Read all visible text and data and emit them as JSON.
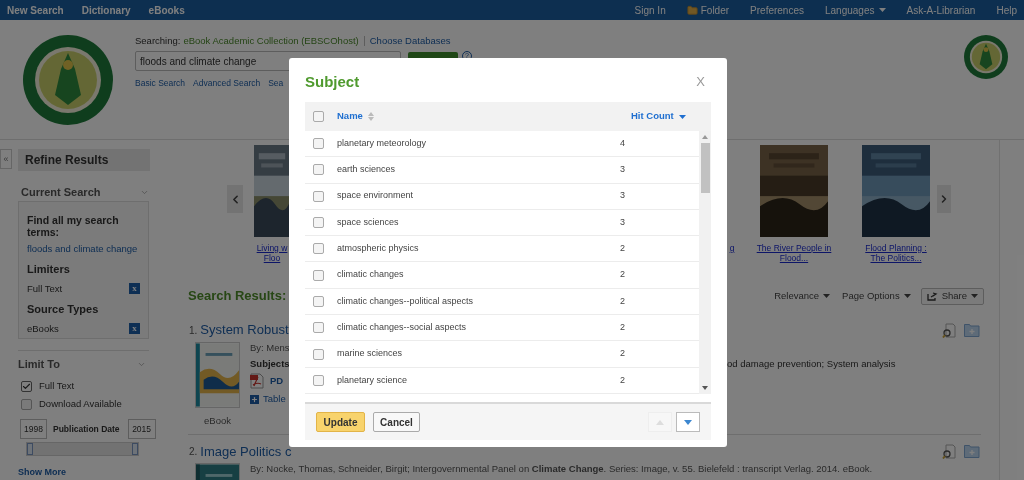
{
  "top_nav": {
    "left": [
      "New Search",
      "Dictionary",
      "eBooks"
    ],
    "right": [
      {
        "label": "Sign In",
        "kind": "link"
      },
      {
        "label": "Folder",
        "kind": "folder"
      },
      {
        "label": "Preferences",
        "kind": "link"
      },
      {
        "label": "Languages",
        "kind": "dropdown"
      },
      {
        "label": "Ask-A-Librarian",
        "kind": "link"
      },
      {
        "label": "Help",
        "kind": "link"
      }
    ]
  },
  "search": {
    "searching_label": "Searching:",
    "database": "eBook Academic Collection (EBSCOhost)",
    "choose_databases": "Choose Databases",
    "query": "floods and climate change",
    "help": "?",
    "links": [
      "Basic Search",
      "Advanced Search",
      "Sea"
    ]
  },
  "sidebar": {
    "collapse": "«",
    "title": "Refine Results",
    "current_search": {
      "heading": "Current Search",
      "find_label": "Find all my search terms:",
      "term": "floods and climate change",
      "limiters_heading": "Limiters",
      "limiters": [
        {
          "label": "Full Text",
          "remove": "x"
        }
      ],
      "source_types_heading": "Source Types",
      "source_types": [
        {
          "label": "eBooks",
          "remove": "x"
        }
      ]
    },
    "limit_to": {
      "heading": "Limit To",
      "options": [
        {
          "label": "Full Text",
          "checked": true
        },
        {
          "label": "Download Available",
          "checked": false
        }
      ],
      "date_from": "1998",
      "date_label": "Publication Date",
      "date_to": "2015",
      "slider_handles": [
        {
          "level": 0
        },
        {
          "level": 1
        }
      ]
    },
    "show_more": "Show More"
  },
  "carousel": {
    "books": [
      {
        "caption": [
          "Living w",
          "Floo"
        ],
        "cover": true
      },
      {
        "caption": [
          "g"
        ],
        "cover": false
      },
      {
        "caption": [
          "The River People in",
          "Flood..."
        ],
        "cover": true
      },
      {
        "caption": [
          "Flood Planning :",
          "The Politics..."
        ],
        "cover": true
      }
    ]
  },
  "results": {
    "heading": "Search Results:",
    "sort": "Relevance",
    "page_options": "Page Options",
    "share": "Share",
    "items": [
      {
        "number": "1.",
        "title": "System Robust",
        "by": "By: Mens",
        "subjects_label": "Subjects",
        "subjects_tail": "od damage prevention; System analysis",
        "pdf": "PD",
        "toc": "Table",
        "type": "eBook"
      },
      {
        "number": "2.",
        "title": "Image Politics c",
        "by": "By: Nocke, Thomas, Schneider, Birgit; Intergovernmental Panel on **Climate Change**. Series: Image, v. 55. Bielefeld : transcript Verlag. 2014. eBook."
      }
    ]
  },
  "modal": {
    "title": "Subject",
    "close": "X",
    "select_all": false,
    "columns": [
      {
        "label": "Name",
        "sorted": false
      },
      {
        "label": "Hit Count",
        "sorted": true
      }
    ],
    "rows": [
      {
        "name": "planetary meteorology",
        "count": "4",
        "checked": false
      },
      {
        "name": "earth sciences",
        "count": "3",
        "checked": false
      },
      {
        "name": "space environment",
        "count": "3",
        "checked": false
      },
      {
        "name": "space sciences",
        "count": "3",
        "checked": false
      },
      {
        "name": "atmospheric physics",
        "count": "2",
        "checked": false
      },
      {
        "name": "climatic changes",
        "count": "2",
        "checked": false
      },
      {
        "name": "climatic changes--political aspects",
        "count": "2",
        "checked": false
      },
      {
        "name": "climatic changes--social aspects",
        "count": "2",
        "checked": false
      },
      {
        "name": "marine sciences",
        "count": "2",
        "checked": false
      },
      {
        "name": "planetary science",
        "count": "2",
        "checked": false
      }
    ],
    "update": "Update",
    "cancel": "Cancel",
    "pager": {
      "up_disabled": true,
      "down_disabled": false
    }
  }
}
